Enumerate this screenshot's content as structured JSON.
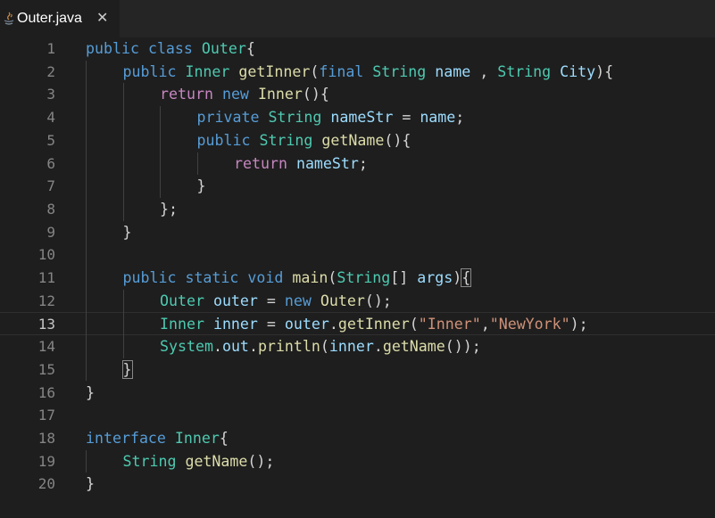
{
  "tab": {
    "title": "Outer.java",
    "close_glyph": "✕",
    "icon": "java-icon"
  },
  "colors": {
    "keyword": "#569cd6",
    "control": "#c586c0",
    "type": "#4ec9b0",
    "function": "#dcdcaa",
    "variable": "#9cdcfe",
    "string": "#ce9178",
    "punctuation": "#d4d4d4",
    "line_number": "#858585",
    "background": "#1e1e1e"
  },
  "editor": {
    "current_line": 13,
    "lines": [
      {
        "n": "1",
        "indent": 0,
        "tokens": [
          [
            "kw",
            "public"
          ],
          [
            "pu",
            " "
          ],
          [
            "kw",
            "class"
          ],
          [
            "pu",
            " "
          ],
          [
            "ty",
            "Outer"
          ],
          [
            "pu",
            "{"
          ]
        ]
      },
      {
        "n": "2",
        "indent": 1,
        "tokens": [
          [
            "kw",
            "public"
          ],
          [
            "pu",
            " "
          ],
          [
            "ty",
            "Inner"
          ],
          [
            "pu",
            " "
          ],
          [
            "fn",
            "getInner"
          ],
          [
            "pu",
            "("
          ],
          [
            "kw",
            "final"
          ],
          [
            "pu",
            " "
          ],
          [
            "ty",
            "String"
          ],
          [
            "pu",
            " "
          ],
          [
            "vr",
            "name"
          ],
          [
            "pu",
            " , "
          ],
          [
            "ty",
            "String"
          ],
          [
            "pu",
            " "
          ],
          [
            "vr",
            "City"
          ],
          [
            "pu",
            "){"
          ]
        ]
      },
      {
        "n": "3",
        "indent": 2,
        "tokens": [
          [
            "ctl",
            "return"
          ],
          [
            "pu",
            " "
          ],
          [
            "kw",
            "new"
          ],
          [
            "pu",
            " "
          ],
          [
            "fn",
            "Inner"
          ],
          [
            "pu",
            "(){"
          ]
        ]
      },
      {
        "n": "4",
        "indent": 3,
        "tokens": [
          [
            "kw",
            "private"
          ],
          [
            "pu",
            " "
          ],
          [
            "ty",
            "String"
          ],
          [
            "pu",
            " "
          ],
          [
            "vr",
            "nameStr"
          ],
          [
            "pu",
            " = "
          ],
          [
            "vr",
            "name"
          ],
          [
            "pu",
            ";"
          ]
        ]
      },
      {
        "n": "5",
        "indent": 3,
        "tokens": [
          [
            "kw",
            "public"
          ],
          [
            "pu",
            " "
          ],
          [
            "ty",
            "String"
          ],
          [
            "pu",
            " "
          ],
          [
            "fn",
            "getName"
          ],
          [
            "pu",
            "(){"
          ]
        ]
      },
      {
        "n": "6",
        "indent": 4,
        "tokens": [
          [
            "ctl",
            "return"
          ],
          [
            "pu",
            " "
          ],
          [
            "vr",
            "nameStr"
          ],
          [
            "pu",
            ";"
          ]
        ]
      },
      {
        "n": "7",
        "indent": 3,
        "tokens": [
          [
            "pu",
            "}"
          ]
        ]
      },
      {
        "n": "8",
        "indent": 2,
        "tokens": [
          [
            "pu",
            "};"
          ]
        ]
      },
      {
        "n": "9",
        "indent": 1,
        "tokens": [
          [
            "pu",
            "}"
          ]
        ]
      },
      {
        "n": "10",
        "indent": 0,
        "tokens": []
      },
      {
        "n": "11",
        "indent": 1,
        "tokens": [
          [
            "kw",
            "public"
          ],
          [
            "pu",
            " "
          ],
          [
            "kw",
            "static"
          ],
          [
            "pu",
            " "
          ],
          [
            "kw",
            "void"
          ],
          [
            "pu",
            " "
          ],
          [
            "fn",
            "main"
          ],
          [
            "pu",
            "("
          ],
          [
            "ty",
            "String"
          ],
          [
            "pu",
            "[] "
          ],
          [
            "vr",
            "args"
          ],
          [
            "pu",
            ")"
          ],
          [
            "bm",
            "{"
          ]
        ]
      },
      {
        "n": "12",
        "indent": 2,
        "tokens": [
          [
            "ty",
            "Outer"
          ],
          [
            "pu",
            " "
          ],
          [
            "vr",
            "outer"
          ],
          [
            "pu",
            " = "
          ],
          [
            "kw",
            "new"
          ],
          [
            "pu",
            " "
          ],
          [
            "fn",
            "Outer"
          ],
          [
            "pu",
            "();"
          ]
        ]
      },
      {
        "n": "13",
        "indent": 2,
        "tokens": [
          [
            "ty",
            "Inner"
          ],
          [
            "pu",
            " "
          ],
          [
            "vr",
            "inner"
          ],
          [
            "pu",
            " = "
          ],
          [
            "vr",
            "outer"
          ],
          [
            "pu",
            "."
          ],
          [
            "fn",
            "getInner"
          ],
          [
            "pu",
            "("
          ],
          [
            "st",
            "\"Inner\""
          ],
          [
            "pu",
            ","
          ],
          [
            "st",
            "\"NewYork\""
          ],
          [
            "pu",
            ");"
          ]
        ]
      },
      {
        "n": "14",
        "indent": 2,
        "tokens": [
          [
            "ty",
            "System"
          ],
          [
            "pu",
            "."
          ],
          [
            "vr",
            "out"
          ],
          [
            "pu",
            "."
          ],
          [
            "fn",
            "println"
          ],
          [
            "pu",
            "("
          ],
          [
            "vr",
            "inner"
          ],
          [
            "pu",
            "."
          ],
          [
            "fn",
            "getName"
          ],
          [
            "pu",
            "());"
          ]
        ]
      },
      {
        "n": "15",
        "indent": 1,
        "tokens": [
          [
            "bm",
            "}"
          ]
        ]
      },
      {
        "n": "16",
        "indent": 0,
        "tokens": [
          [
            "pu",
            "}"
          ]
        ]
      },
      {
        "n": "17",
        "indent": 0,
        "tokens": []
      },
      {
        "n": "18",
        "indent": 0,
        "tokens": [
          [
            "kw",
            "interface"
          ],
          [
            "pu",
            " "
          ],
          [
            "ty",
            "Inner"
          ],
          [
            "pu",
            "{"
          ]
        ]
      },
      {
        "n": "19",
        "indent": 1,
        "tokens": [
          [
            "ty",
            "String"
          ],
          [
            "pu",
            " "
          ],
          [
            "fn",
            "getName"
          ],
          [
            "pu",
            "();"
          ]
        ]
      },
      {
        "n": "20",
        "indent": 0,
        "tokens": [
          [
            "pu",
            "}"
          ]
        ]
      }
    ]
  }
}
